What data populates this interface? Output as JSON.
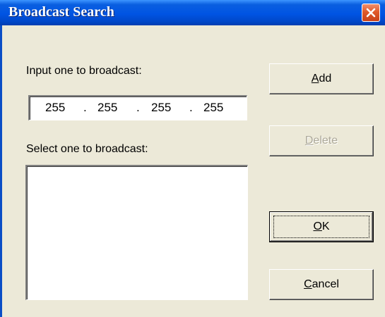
{
  "window": {
    "title": "Broadcast Search"
  },
  "input_section": {
    "label": "Input one to broadcast:",
    "ip": {
      "octet1": "255",
      "octet2": "255",
      "octet3": "255",
      "octet4": "255",
      "separator": "."
    }
  },
  "select_section": {
    "label": "Select one to broadcast:",
    "items": []
  },
  "buttons": {
    "add": {
      "mnemonic": "A",
      "rest": "dd",
      "enabled": true
    },
    "delete": {
      "mnemonic": "D",
      "rest": "elete",
      "enabled": false
    },
    "ok": {
      "mnemonic": "O",
      "rest": "K",
      "enabled": true,
      "default": true
    },
    "cancel": {
      "mnemonic": "C",
      "rest": "ancel",
      "enabled": true
    }
  },
  "icons": {
    "close": "close-icon"
  },
  "colors": {
    "titlebar": "#0054e3",
    "close_button": "#e05a2a",
    "dialog_face": "#ece9d8",
    "disabled_text": "#aca899"
  }
}
